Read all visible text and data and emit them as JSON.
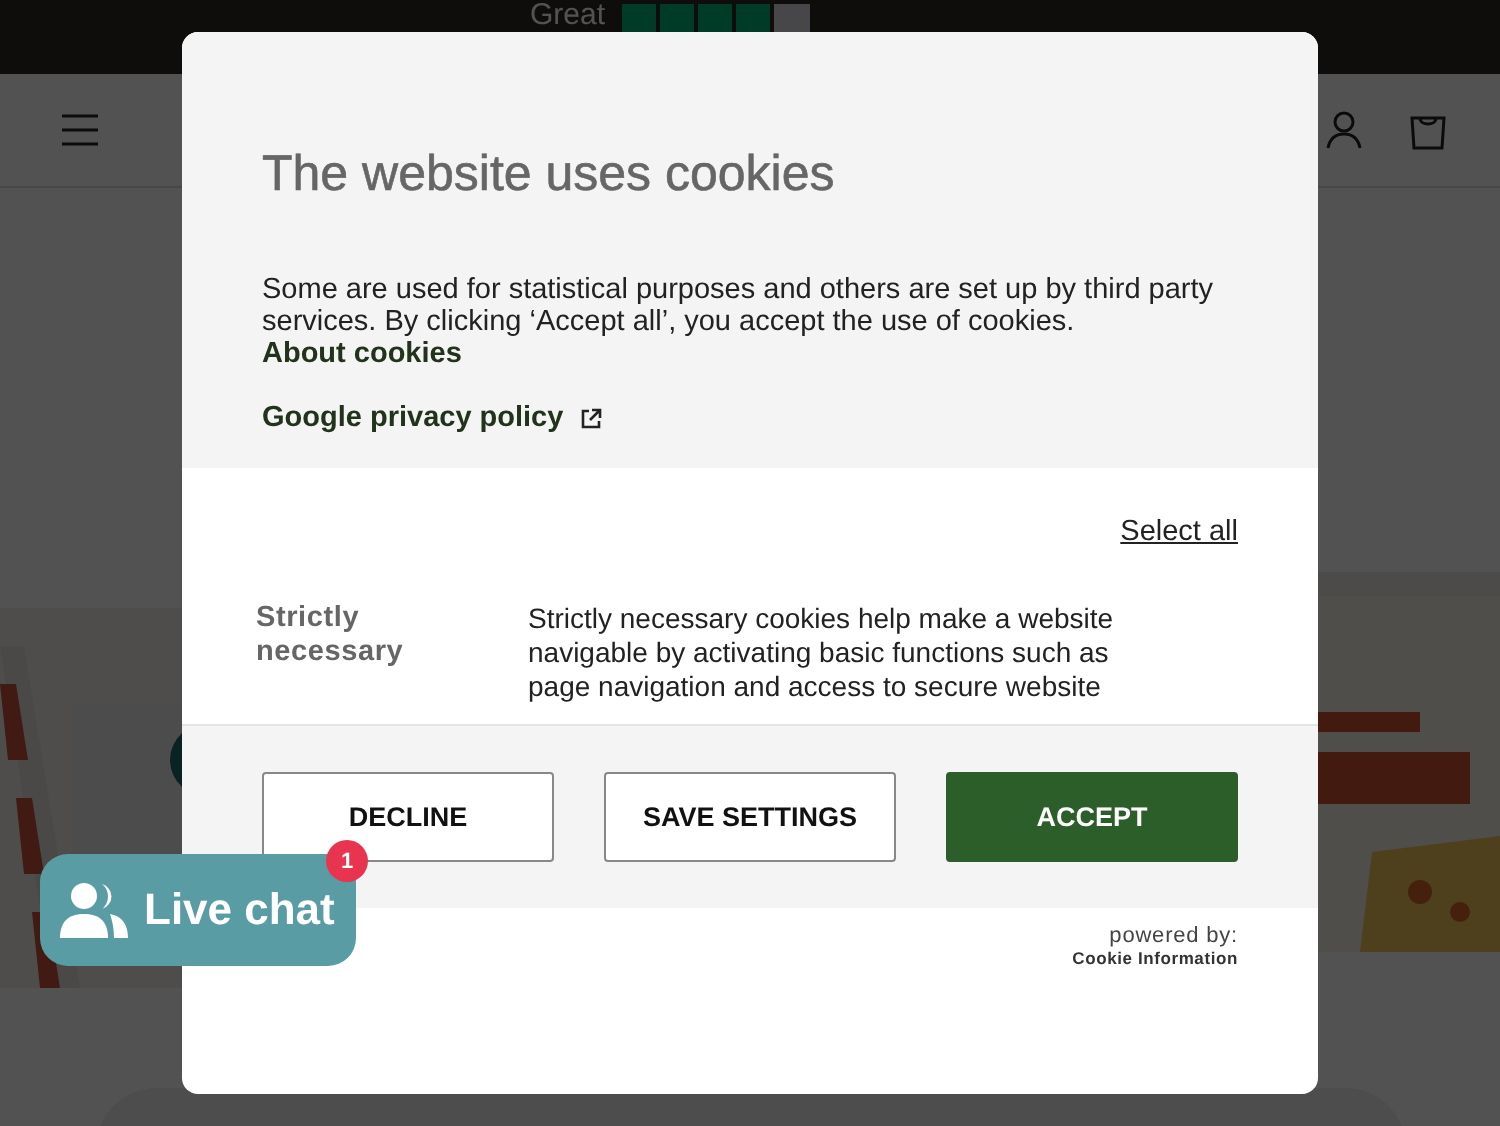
{
  "announcement": {
    "text": "Great"
  },
  "dialog": {
    "title": "The website uses cookies",
    "intro": "Some are used for statistical purposes and others are set up by third party services. By clicking ‘Accept all’, you accept the use of cookies.",
    "links": [
      {
        "label": "About cookies",
        "external": false
      },
      {
        "label": "Google privacy policy",
        "external": true
      }
    ],
    "select_all": "Select all",
    "categories": [
      {
        "name": "Strictly necessary",
        "description": "Strictly necessary cookies help make a website navigable by activating basic functions such as page navigation and access to secure website"
      }
    ],
    "buttons": [
      {
        "label": "DECLINE",
        "kind": "outline"
      },
      {
        "label": "SAVE SETTINGS",
        "kind": "outline"
      },
      {
        "label": "ACCEPT",
        "kind": "primary"
      }
    ],
    "powered_by": "powered by:",
    "provider": "Cookie Information"
  },
  "live_chat": {
    "label": "Live chat",
    "badge": "1"
  }
}
